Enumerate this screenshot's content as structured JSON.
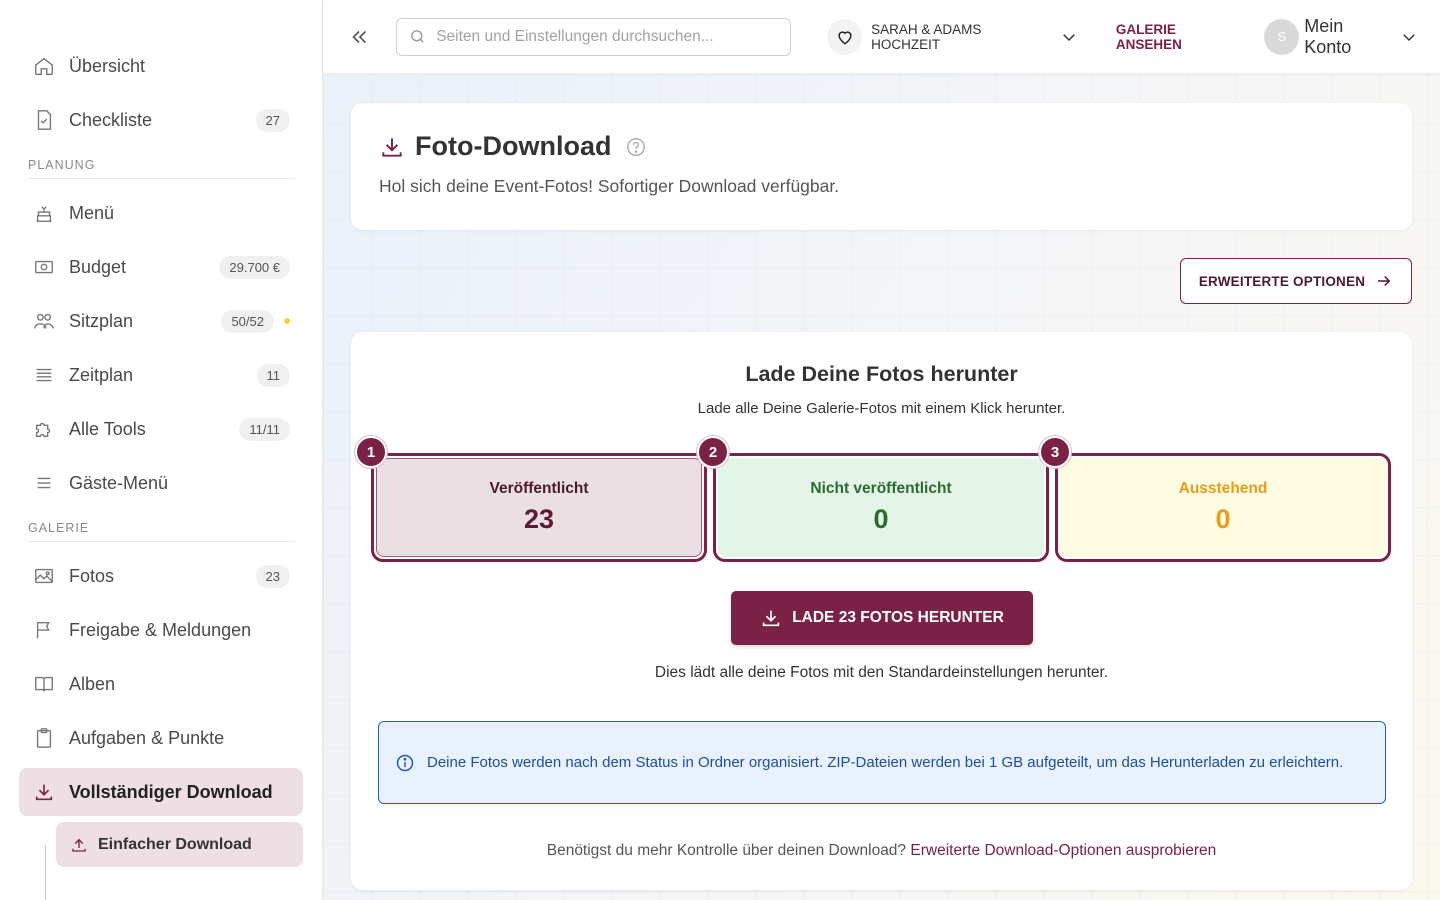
{
  "sidebar": {
    "top_items": [
      {
        "label": "Übersicht",
        "icon": "home-icon"
      },
      {
        "label": "Checkliste",
        "icon": "checklist-icon",
        "badge": "27"
      }
    ],
    "planning_label": "PLANUNG",
    "planning_items": [
      {
        "label": "Menü",
        "icon": "cake-icon"
      },
      {
        "label": "Budget",
        "icon": "money-icon",
        "badge": "29.700 €"
      },
      {
        "label": "Sitzplan",
        "icon": "people-icon",
        "badge": "50/52"
      },
      {
        "label": "Zeitplan",
        "icon": "lines-icon",
        "badge": "11"
      },
      {
        "label": "Alle Tools",
        "icon": "puzzle-icon",
        "badge": "11/11"
      },
      {
        "label": "Gäste-Menü",
        "icon": "menu-icon"
      }
    ],
    "gallery_label": "GALERIE",
    "gallery_items": [
      {
        "label": "Fotos",
        "icon": "image-icon",
        "badge": "23"
      },
      {
        "label": "Freigabe & Meldungen",
        "icon": "flag-icon"
      },
      {
        "label": "Alben",
        "icon": "book-icon"
      },
      {
        "label": "Aufgaben & Punkte",
        "icon": "clipboard-icon"
      },
      {
        "label": "Vollständiger Download",
        "icon": "download-icon"
      }
    ],
    "sub_item": {
      "label": "Einfacher Download",
      "icon": "upload-icon"
    },
    "seating_dot_color": "#f3d33a"
  },
  "topbar": {
    "search_placeholder": "Seiten und Einstellungen durchsuchen...",
    "event_name": "SARAH & ADAMS HOCHZEIT",
    "gallery_link": "GALERIE ANSEHEN",
    "avatar_initial": "S",
    "account_label": "Mein Konto"
  },
  "header": {
    "title": "Foto-Download",
    "subtitle": "Hol sich deine Event-Fotos! Sofortiger Download verfügbar."
  },
  "advanced_button": "ERWEITERTE OPTIONEN",
  "download": {
    "title": "Lade Deine Fotos herunter",
    "description": "Lade alle Deine Galerie-Fotos mit einem Klick herunter.",
    "stats": [
      {
        "step": "1",
        "label": "Veröffentlicht",
        "value": "23"
      },
      {
        "step": "2",
        "label": "Nicht veröffentlicht",
        "value": "0"
      },
      {
        "step": "3",
        "label": "Ausstehend",
        "value": "0"
      }
    ],
    "button_label": "LADE 23 FOTOS HERUNTER",
    "button_note": "Dies lädt alle deine Fotos mit den Standardeinstellungen herunter.",
    "info_text": "Deine Fotos werden nach dem Status in Ordner organisiert. ZIP-Dateien werden bei 1 GB aufgeteilt, um das Herunterladen zu erleichtern.",
    "footer_prefix": "Benötigst du mehr Kontrolle über deinen Download?",
    "footer_link": "Erweiterte Download-Optionen ausprobieren"
  },
  "colors": {
    "brand": "#7a2246",
    "info": "#1f5fb3",
    "success": "#2a6b2f",
    "pending": "#e59d1c"
  }
}
